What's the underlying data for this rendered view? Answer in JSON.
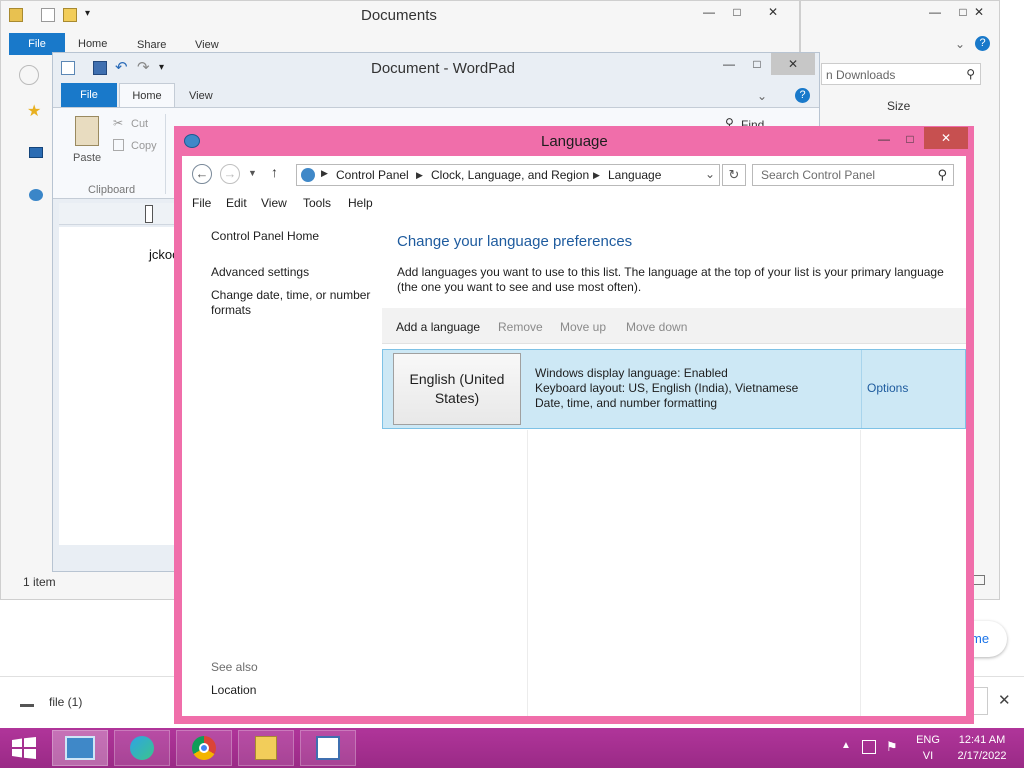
{
  "documents_window": {
    "title": "Documents",
    "tabs": {
      "file": "File",
      "share": "Share",
      "view": "View"
    },
    "status": "1 item"
  },
  "downloads_window": {
    "search_placeholder": "n Downloads",
    "column_size": "Size",
    "partial_link": "me"
  },
  "download_bar": {
    "file_label": "file (1)"
  },
  "wordpad": {
    "title": "Document - WordPad",
    "tabs": {
      "file": "File",
      "home": "Home",
      "view": "View"
    },
    "paste": "Paste",
    "cut": "Cut",
    "copy": "Copy",
    "clipboard_group": "Clipboard",
    "find": "Find",
    "doc_text": "jckoo"
  },
  "language_window": {
    "title": "Language",
    "breadcrumb": [
      "Control Panel",
      "Clock, Language, and Region",
      "Language"
    ],
    "search_placeholder": "Search Control Panel",
    "menu": [
      "File",
      "Edit",
      "View",
      "Tools",
      "Help"
    ],
    "sidebar": {
      "home": "Control Panel Home",
      "advanced": "Advanced settings",
      "date_time": "Change date, time, or number formats",
      "see_also": "See also",
      "location": "Location"
    },
    "heading": "Change your language preferences",
    "description": "Add languages you want to use to this list. The language at the top of your list is your primary language (the one you want to see and use most often).",
    "toolbar": {
      "add": "Add a language",
      "remove": "Remove",
      "move_up": "Move up",
      "move_down": "Move down"
    },
    "languages": [
      {
        "name": "English (United States)",
        "display": "Windows display language: Enabled",
        "keyboard": "Keyboard layout: US, English (India), Vietnamese",
        "formatting": "Date, time, and number formatting",
        "options": "Options"
      }
    ]
  },
  "taskbar": {
    "lang_top": "ENG",
    "lang_bottom": "VI",
    "time": "12:41 AM",
    "date": "2/17/2022"
  },
  "colors": {
    "accent_window": "#f06eaa",
    "ribbon_file": "#1979ca",
    "heading_blue": "#1e5b9e",
    "taskbar": "#a02f8c"
  }
}
